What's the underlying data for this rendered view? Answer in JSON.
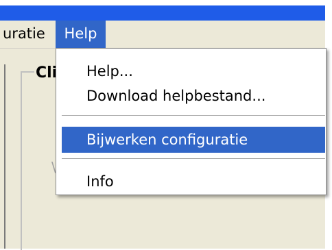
{
  "menubar": {
    "prev_menu_label": "uratie",
    "help_menu_label": "Help"
  },
  "window": {
    "group_title": "Cli"
  },
  "help_menu": {
    "items": [
      {
        "label": "Help..."
      },
      {
        "label": "Download helpbestand..."
      },
      {
        "label": "Bijwerken configuratie"
      },
      {
        "label": "Info"
      }
    ]
  },
  "colors": {
    "titlebar": "#1f5ce8",
    "menu_highlight": "#3166c8",
    "window_background": "#ece9d8"
  }
}
